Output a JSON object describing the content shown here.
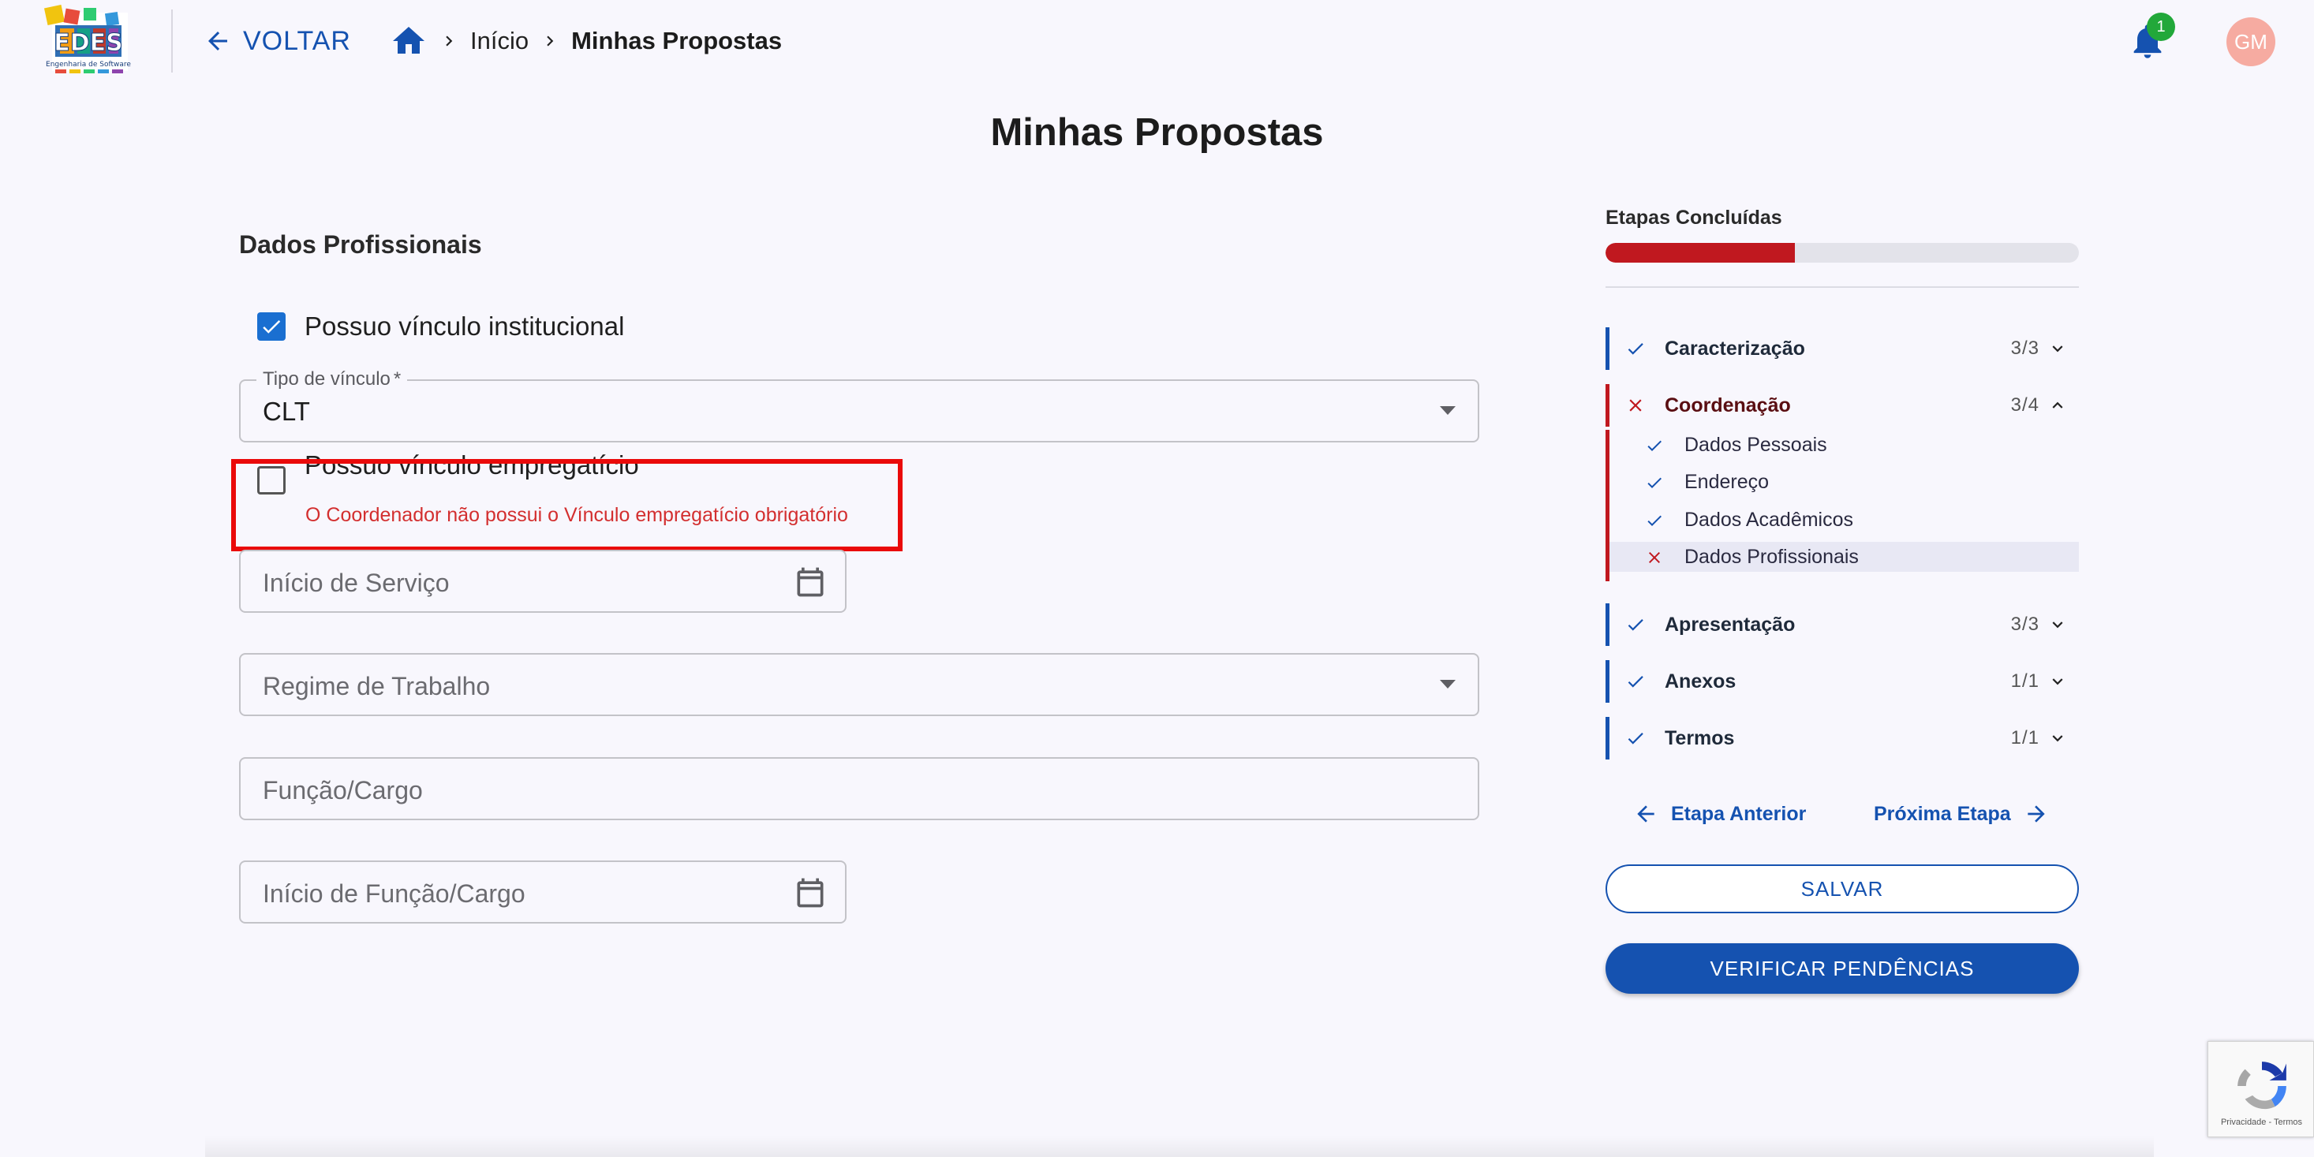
{
  "header": {
    "logo_text": "EDES",
    "logo_subtext": "Engenharia de Software",
    "back_label": "VOLTAR",
    "breadcrumb": {
      "home_icon": "home-icon",
      "items": [
        "Início",
        "Minhas Propostas"
      ]
    },
    "notifications_count": "1",
    "avatar_initials": "GM"
  },
  "page": {
    "title": "Minhas Propostas"
  },
  "form": {
    "section_title": "Dados Profissionais",
    "institutional_checkbox": {
      "label": "Possuo vínculo institucional",
      "checked": true
    },
    "tipo_vinculo": {
      "label": "Tipo de vínculo",
      "required_mark": "*",
      "value": "CLT"
    },
    "employment_checkbox": {
      "label": "Possuo vínculo empregatício",
      "checked": false,
      "error": "O Coordenador não possui o Vínculo empregatício obrigatório"
    },
    "inicio_servico": {
      "placeholder": "Início de Serviço"
    },
    "regime_trabalho": {
      "placeholder": "Regime de Trabalho"
    },
    "funcao_cargo": {
      "placeholder": "Função/Cargo"
    },
    "inicio_funcao": {
      "placeholder": "Início de Função/Cargo"
    }
  },
  "progress": {
    "title": "Etapas Concluídas",
    "fraction": 0.4,
    "fill_color": "#c0181f",
    "steps": [
      {
        "label": "Caracterização",
        "count": "3/3",
        "status": "done",
        "expanded": false
      },
      {
        "label": "Coordenação",
        "count": "3/4",
        "status": "error",
        "expanded": true,
        "sub_steps": [
          {
            "label": "Dados Pessoais",
            "status": "done"
          },
          {
            "label": "Endereço",
            "status": "done"
          },
          {
            "label": "Dados Acadêmicos",
            "status": "done"
          },
          {
            "label": "Dados Profissionais",
            "status": "error",
            "active": true
          }
        ]
      },
      {
        "label": "Apresentação",
        "count": "3/3",
        "status": "done",
        "expanded": false
      },
      {
        "label": "Anexos",
        "count": "1/1",
        "status": "done",
        "expanded": false
      },
      {
        "label": "Termos",
        "count": "1/1",
        "status": "done",
        "expanded": false
      }
    ],
    "prev_label": "Etapa Anterior",
    "next_label": "Próxima Etapa",
    "save_label": "SALVAR",
    "verify_label": "VERIFICAR PENDÊNCIAS"
  },
  "recaptcha": {
    "text": "Privacidade - Termos"
  },
  "colors": {
    "primary": "#1552b0",
    "error": "#c0181f",
    "highlight_box": "#ea0a0a",
    "badge": "#22a83a",
    "avatar": "#f6aba1"
  }
}
